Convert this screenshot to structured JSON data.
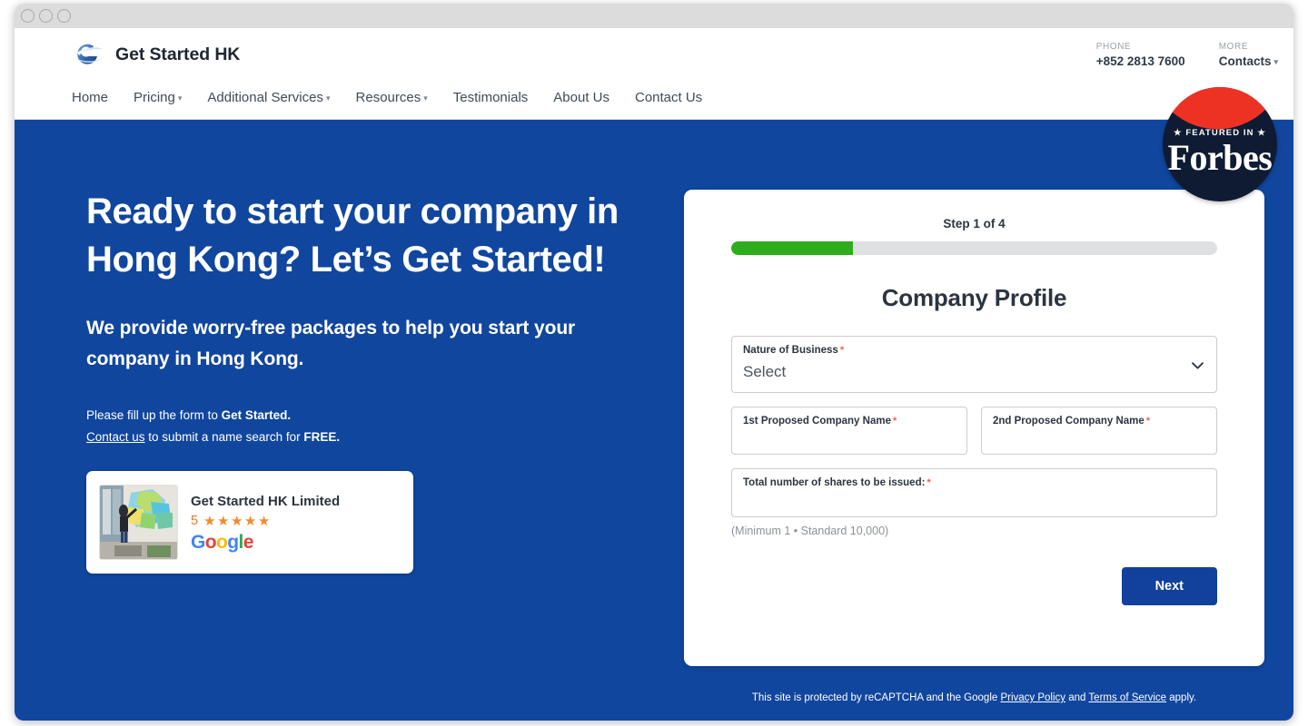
{
  "window": {
    "dots": [
      "close",
      "minimize",
      "maximize"
    ]
  },
  "header": {
    "brand_name": "Get Started HK",
    "logo_icon": "swirl-globe-logo",
    "nav": [
      {
        "label": "Home",
        "has_caret": false
      },
      {
        "label": "Pricing",
        "has_caret": true
      },
      {
        "label": "Additional Services",
        "has_caret": true
      },
      {
        "label": "Resources",
        "has_caret": true
      },
      {
        "label": "Testimonials",
        "has_caret": false
      },
      {
        "label": "About Us",
        "has_caret": false
      },
      {
        "label": "Contact Us",
        "has_caret": false
      }
    ],
    "phone_label": "PHONE",
    "phone_value": "+852 2813 7600",
    "more_label": "MORE",
    "more_value": "Contacts"
  },
  "badge": {
    "featured_text": "★ FEATURED IN ★",
    "publication": "Forbes"
  },
  "hero": {
    "title_regular": "Ready to start your company in Hong Kong? ",
    "title_strong": "Let’s Get Started!",
    "subtitle": "We provide worry-free packages to help you start your company in Hong Kong.",
    "note_line1_pre": "Please fill up the form to ",
    "note_line1_bold": "Get Started.",
    "note_line2_link": "Contact us",
    "note_line2_mid": " to submit a name search for ",
    "note_line2_bold": "FREE.",
    "background_color": "#10469E"
  },
  "review_card": {
    "business_name": "Get Started HK Limited",
    "rating_value": "5",
    "stars": "★★★★★",
    "source": "Google",
    "thumbnail_alt": "person-pointing-at-colorful-map-photo"
  },
  "form": {
    "step_label": "Step 1 of 4",
    "progress_percent": 25,
    "progress_color": "#2EAC1E",
    "heading": "Company Profile",
    "fields": {
      "nature_of_business": {
        "label": "Nature of Business",
        "required_marker": "*",
        "selected_value": "Select"
      },
      "first_company_name": {
        "label": "1st Proposed Company Name",
        "required_marker": "*",
        "value": ""
      },
      "second_company_name": {
        "label": "2nd Proposed Company Name",
        "required_marker": "*",
        "value": ""
      },
      "total_shares": {
        "label": "Total number of shares to be issued:",
        "required_marker": "*",
        "value": "",
        "helper": "(Minimum 1 • Standard 10,000)"
      }
    },
    "next_label": "Next"
  },
  "footer": {
    "recaptcha_pre": "This site is protected by reCAPTCHA and the Google ",
    "privacy_link": "Privacy Policy",
    "recaptcha_mid": " and ",
    "terms_link": "Terms of Service",
    "recaptcha_post": " apply."
  }
}
